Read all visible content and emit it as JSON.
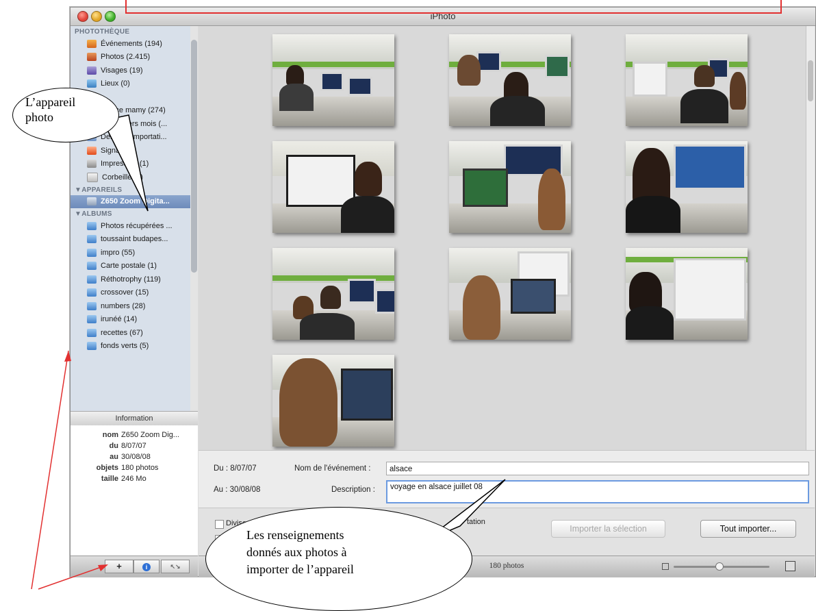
{
  "window": {
    "title": "iPhoto"
  },
  "sidebar": {
    "library_header": "PHOTOTHÈQUE",
    "library_items": [
      {
        "label": "Événements (194)",
        "icon": "events-icon"
      },
      {
        "label": "Photos (2.415)",
        "icon": "photos-icon"
      },
      {
        "label": "Visages (19)",
        "icon": "faces-icon"
      },
      {
        "label": "Lieux (0)",
        "icon": "places-icon"
      },
      {
        "label": "",
        "icon": ""
      },
      {
        "label": "Alsace mamy (274)",
        "icon": "album-icon"
      },
      {
        "label": "12 derniers mois (...",
        "icon": "smart-album-icon"
      },
      {
        "label": "Dernière importati...",
        "icon": "import-icon"
      },
      {
        "label": "Signalées",
        "icon": "flag-icon"
      },
      {
        "label": "Impression (1)",
        "icon": "print-icon"
      },
      {
        "label": "Corbeille (1)",
        "icon": "trash-icon"
      }
    ],
    "devices_header": "▼APPAREILS",
    "device_item": "Z650 Zoom Digita...",
    "albums_header": "▼ALBUMS",
    "albums": [
      "Photos récupérées ...",
      "toussaint budapes...",
      "impro (55)",
      "Carte postale (1)",
      "Réthotrophy (119)",
      "crossover (15)",
      "numbers (28)",
      "irunéé (14)",
      "recettes (67)",
      "fonds verts (5)"
    ]
  },
  "info": {
    "header": "Information",
    "rows": [
      {
        "key": "nom",
        "value": "Z650 Zoom Dig..."
      },
      {
        "key": "du",
        "value": "8/07/07"
      },
      {
        "key": "au",
        "value": "30/08/08"
      },
      {
        "key": "objets",
        "value": "180 photos"
      },
      {
        "key": "taille",
        "value": "246 Mo"
      }
    ]
  },
  "bottom_buttons": {
    "add": "+",
    "info": "i",
    "fullscreen": "↖↘"
  },
  "import_form": {
    "from_label": "Du : 8/07/07",
    "to_label": "Au : 30/08/08",
    "event_name_label": "Nom de l'événement :",
    "event_name_value": "alsace",
    "description_label": "Description :",
    "description_value": "voyage en alsace juillet 08"
  },
  "options": {
    "split_events_label_start": "Diviser ",
    "split_events_label_end": "tation",
    "import_selection": "Importer la sélection",
    "import_all": "Tout importer..."
  },
  "status": {
    "count": "180 photos"
  },
  "annotations": {
    "camera_bubble_line1": "L’appareil",
    "camera_bubble_line2": "photo",
    "info_bubble_line1": "Les renseignements",
    "info_bubble_line2": "donnés aux photos à",
    "info_bubble_line3": "importer de l’appareil"
  },
  "colors": {
    "selection": "#6d8bbb",
    "sidebar_bg": "#d8e0ea",
    "annotation_red": "#e23030",
    "focus_ring": "#6b9ae0"
  }
}
